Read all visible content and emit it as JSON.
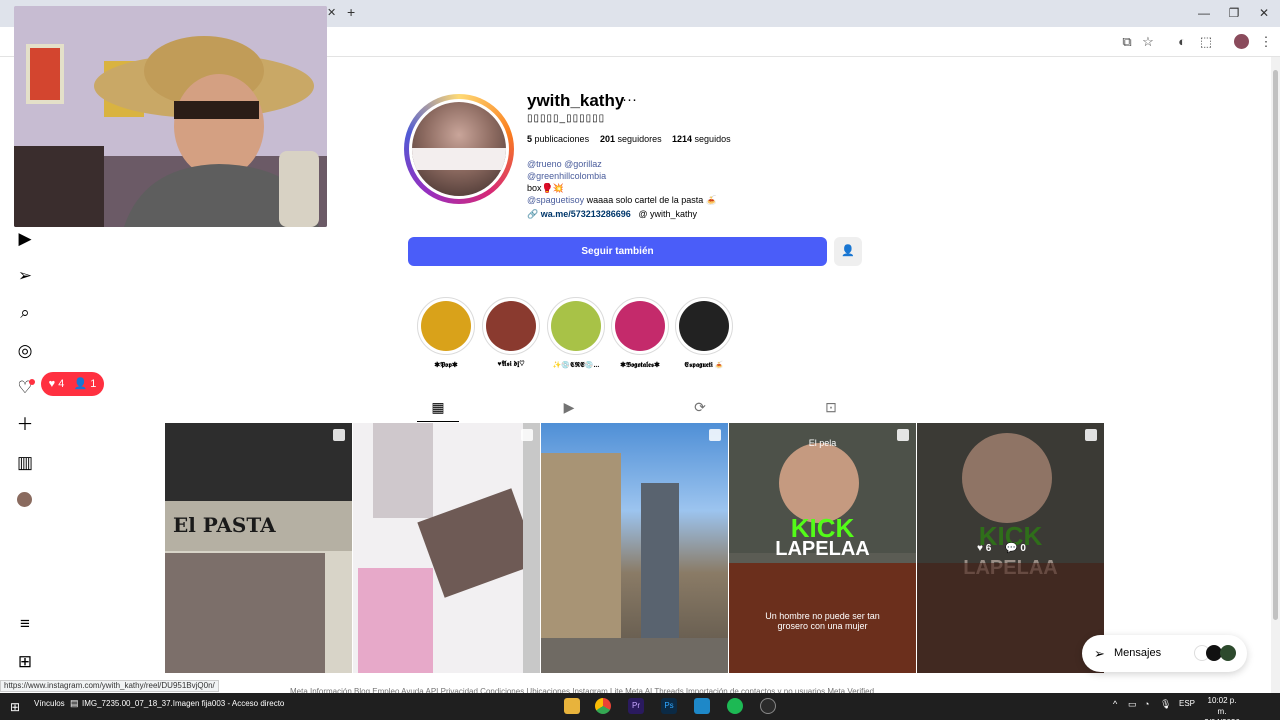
{
  "browser": {
    "new_tab": "+",
    "tab_close": "✕",
    "win_minimize": "—",
    "win_restore": "❐",
    "win_close": "✕",
    "status_url": "https://www.instagram.com/ywith_kathy/reel/DU951BvjQ0n/"
  },
  "notifications": {
    "likes": "4",
    "follows": "1"
  },
  "profile": {
    "username": "ywith_kathy",
    "more": "···",
    "full_name": "▯▯▯▯▯_▯▯▯▯▯▯",
    "posts_count": "5",
    "posts_label": "publicaciones",
    "followers_count": "201",
    "followers_label": "seguidores",
    "following_count": "1214",
    "following_label": "seguidos",
    "bio_mentions_1": "@trueno @gorillaz",
    "bio_mention_2": "@greenhillcolombia",
    "bio_line_3": "box🥊💥",
    "bio_mention_4": "@spaguetisoy",
    "bio_line_4_rest": " waaaa solo cartel de la pasta 🍝",
    "link": "wa.me/573213286696",
    "threads_handle": "ywith_kathy",
    "follow_button": "Seguir también",
    "suggest_icon": "person-add-icon"
  },
  "highlights": [
    {
      "label": "✱𝕻𝖔𝖕✱",
      "color": "#d9a21a"
    },
    {
      "label": "♥𝕬𝖘𝖎 𝖉𝖏♡",
      "color": "#8a3a2f"
    },
    {
      "label": "✨💿𝕮𝕽𝕰💿...",
      "color": "#a8c247"
    },
    {
      "label": "✱𝕭𝖔𝖌𝖔𝖙𝖆𝖑𝖊𝖘✱",
      "color": "#c42a6b"
    },
    {
      "label": "𝕰𝖘𝖕𝖆𝖌𝖚𝖊𝖙𝖎 🍝",
      "color": "#222222"
    }
  ],
  "grid_posts": [
    {
      "text": "El PASTA",
      "likes": "",
      "comments": ""
    },
    {
      "text": "",
      "likes": "",
      "comments": ""
    },
    {
      "text": "",
      "likes": "",
      "comments": ""
    },
    {
      "text_top": "El pela",
      "text_kick": "KICK",
      "text_name": "LAPELAA",
      "caption": "Un hombre no puede ser tan grosero con una mujer",
      "likes": "",
      "comments": ""
    },
    {
      "text_kick": "KICK",
      "text_name": "LAPELAA",
      "likes": "6",
      "comments": "0"
    }
  ],
  "messages": {
    "label": "Mensajes"
  },
  "footer_links": "Meta   Información   Blog   Empleo   Ayuda   API   Privacidad   Condiciones   Ubicaciones   Instagram Lite   Meta AI   Threads   Importación de contactos y no usuarios   Meta Verified",
  "taskbar": {
    "links": "Vínculos",
    "window_title": "IMG_7235.00_07_18_37.Imagen fija003 - Acceso directo",
    "language": "ESP",
    "time": "10:02 p. m.",
    "date": "3/04/2026"
  }
}
